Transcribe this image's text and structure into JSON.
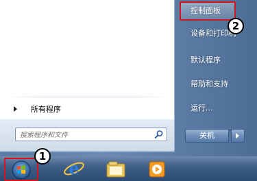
{
  "start_menu": {
    "all_programs_label": "所有程序",
    "search_placeholder": "搜索程序和文件",
    "right_items": [
      "控制面板",
      "设备和打印机",
      "默认程序",
      "帮助和支持",
      "运行..."
    ],
    "shutdown_label": "关机"
  },
  "callouts": [
    "1",
    "2"
  ],
  "colors": {
    "highlight_border": "#d0161c",
    "glass_blue": "#5b7ba3"
  },
  "taskbar": {
    "icons": [
      "windows-start-orb-icon",
      "internet-explorer-icon",
      "windows-explorer-icon",
      "media-player-icon"
    ]
  }
}
